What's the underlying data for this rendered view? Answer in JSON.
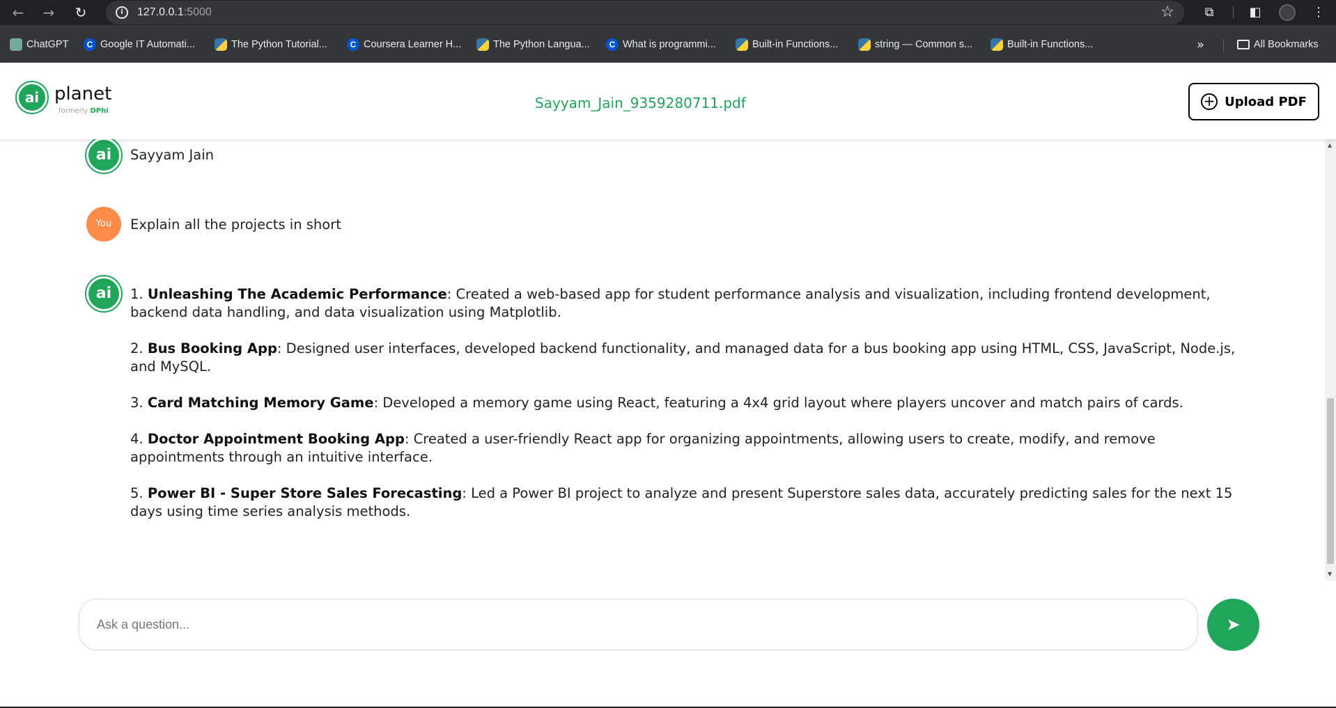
{
  "browser": {
    "url_host": "127.0.0.1",
    "url_port": ":5000",
    "bookmarks": [
      {
        "label": "ChatGPT",
        "icon": "chatgpt-icon"
      },
      {
        "label": "Google IT Automati...",
        "icon": "coursera-icon"
      },
      {
        "label": "The Python Tutorial...",
        "icon": "python-icon"
      },
      {
        "label": "Coursera Learner H...",
        "icon": "coursera-icon"
      },
      {
        "label": "The Python Langua...",
        "icon": "python-icon"
      },
      {
        "label": "What is programmi...",
        "icon": "coursera-icon"
      },
      {
        "label": "Built-in Functions...",
        "icon": "python-icon"
      },
      {
        "label": "string — Common s...",
        "icon": "python-icon"
      },
      {
        "label": "Built-in Functions...",
        "icon": "python-icon"
      }
    ],
    "all_bookmarks_label": "All Bookmarks"
  },
  "header": {
    "logo_mark": "ai",
    "logo_word": "planet",
    "logo_sub_prefix": "formerly",
    "logo_sub_brand": "DPhi",
    "filename": "Sayyam_Jain_9359280711.pdf",
    "upload_label": "Upload PDF",
    "brand_color": "#1fa65a"
  },
  "chat": {
    "ai_avatar_text": "ai",
    "you_avatar_text": "You",
    "messages": [
      {
        "role": "ai",
        "text": "Sayyam Jain"
      },
      {
        "role": "user",
        "text": "Explain all the projects in short"
      }
    ],
    "answer": [
      {
        "num": "1.",
        "title": "Unleashing The Academic Performance",
        "desc": ": Created a web-based app for student performance analysis and visualization, including frontend development, backend data handling, and data visualization using Matplotlib."
      },
      {
        "num": "2.",
        "title": "Bus Booking App",
        "desc": ": Designed user interfaces, developed backend functionality, and managed data for a bus booking app using HTML, CSS, JavaScript, Node.js, and MySQL."
      },
      {
        "num": "3.",
        "title": "Card Matching Memory Game",
        "desc": ": Developed a memory game using React, featuring a 4x4 grid layout where players uncover and match pairs of cards."
      },
      {
        "num": "4.",
        "title": "Doctor Appointment Booking App",
        "desc": ": Created a user-friendly React app for organizing appointments, allowing users to create, modify, and remove appointments through an intuitive interface."
      },
      {
        "num": "5.",
        "title": "Power BI - Super Store Sales Forecasting",
        "desc": ": Led a Power BI project to analyze and present Superstore sales data, accurately predicting sales for the next 15 days using time series analysis methods."
      }
    ]
  },
  "input": {
    "placeholder": "Ask a question...",
    "value": ""
  }
}
